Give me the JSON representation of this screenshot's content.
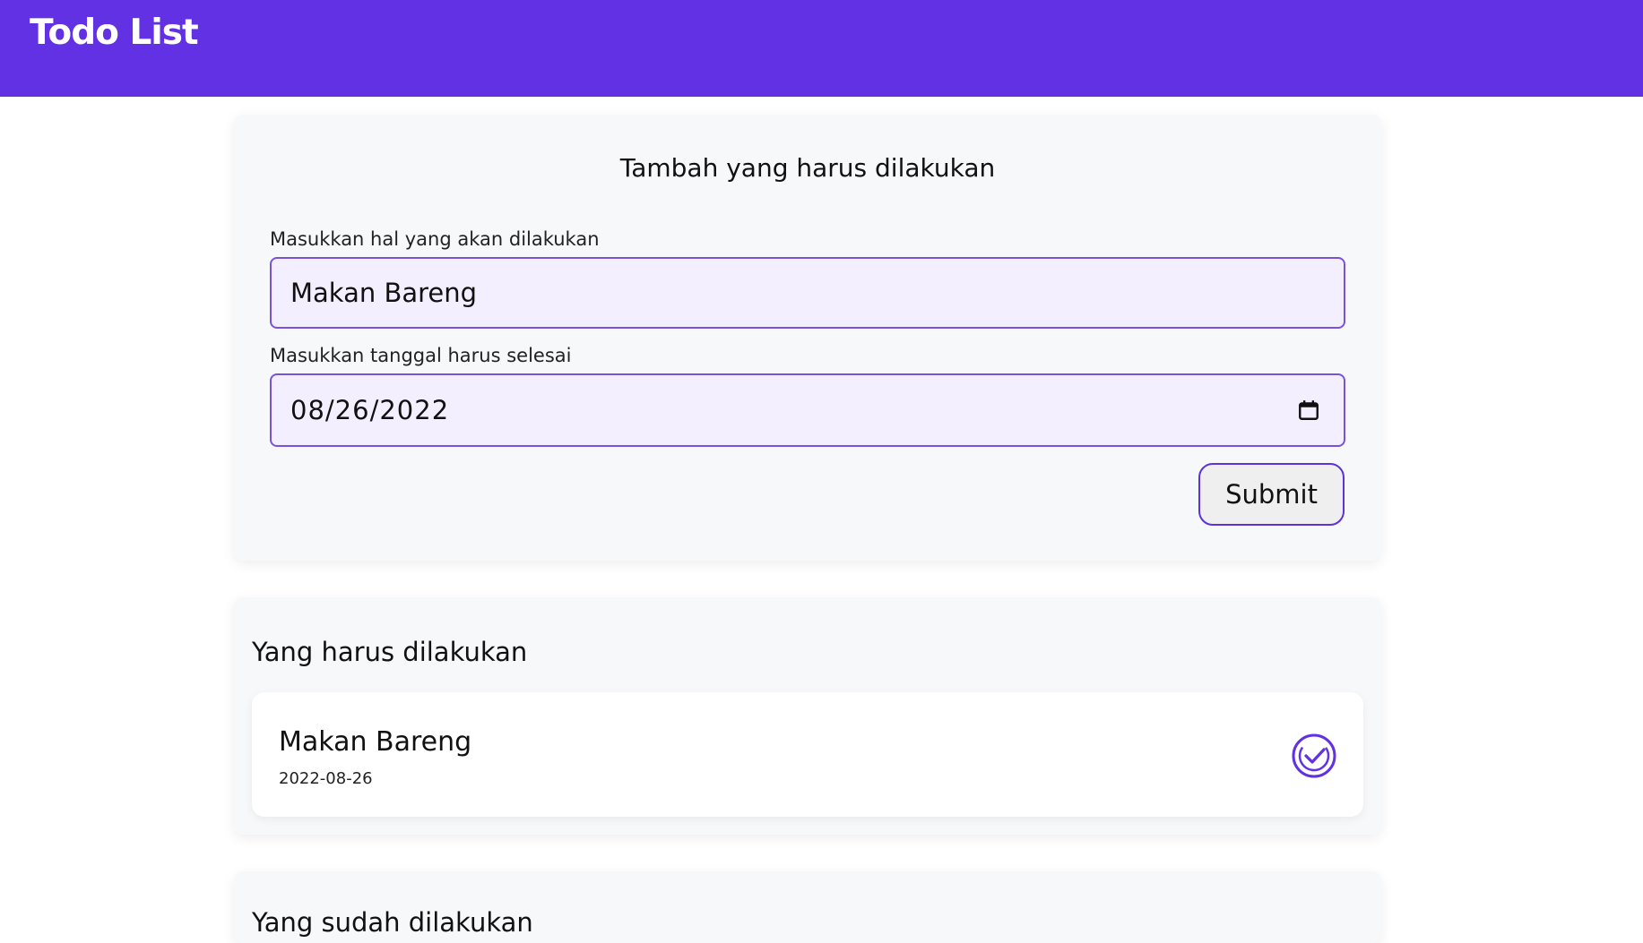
{
  "app": {
    "title": "Todo List",
    "accent_color": "#6231e4"
  },
  "form": {
    "heading": "Tambah yang harus dilakukan",
    "title_label": "Masukkan hal yang akan dilakukan",
    "title_value": "Makan Bareng",
    "date_label": "Masukkan tanggal harus selesai",
    "date_value": "08/26/2022",
    "date_icon": "calendar-icon",
    "submit_label": "Submit"
  },
  "todo_section": {
    "heading": "Yang harus dilakukan",
    "items": [
      {
        "title": "Makan Bareng",
        "date": "2022-08-26",
        "action_icon": "check-circle-icon"
      }
    ]
  },
  "done_section": {
    "heading": "Yang sudah dilakukan"
  }
}
